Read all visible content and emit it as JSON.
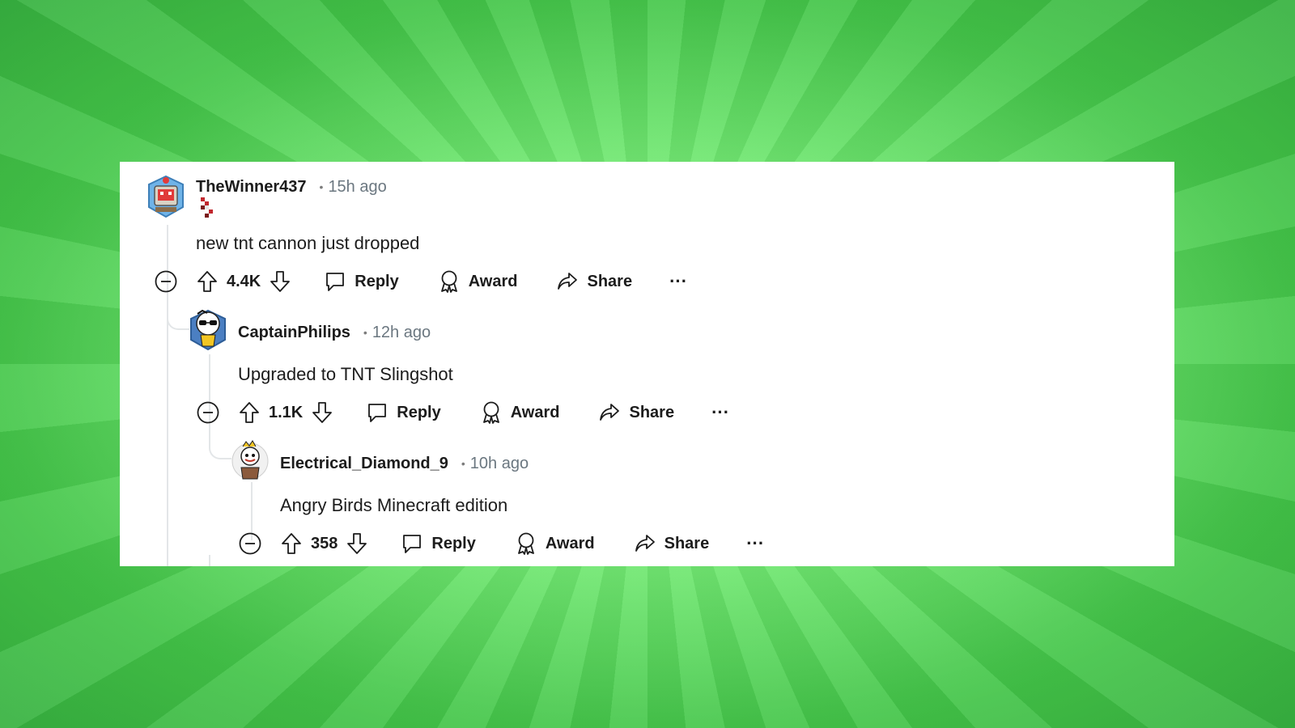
{
  "comments": [
    {
      "username": "TheWinner437",
      "separator": "•",
      "time": "15h ago",
      "text": "new tnt cannon just dropped",
      "votes": "4.4K",
      "reply_label": "Reply",
      "award_label": "Award",
      "share_label": "Share",
      "more_label": "···"
    },
    {
      "username": "CaptainPhilips",
      "separator": "•",
      "time": "12h ago",
      "text": "Upgraded to TNT Slingshot",
      "votes": "1.1K",
      "reply_label": "Reply",
      "award_label": "Award",
      "share_label": "Share",
      "more_label": "···"
    },
    {
      "username": "Electrical_Diamond_9",
      "separator": "•",
      "time": "10h ago",
      "text": "Angry Birds Minecraft edition",
      "votes": "358",
      "reply_label": "Reply",
      "award_label": "Award",
      "share_label": "Share",
      "more_label": "···"
    }
  ],
  "colors": {
    "background_green": "#6ef06e",
    "card": "#ffffff",
    "text": "#1c1c1c",
    "muted": "#6b7780",
    "thread_line": "#e3e6e8"
  },
  "icons": [
    "avatar-robot",
    "flair-pixel",
    "collapse-icon",
    "upvote-icon",
    "downvote-icon",
    "reply-icon",
    "award-icon",
    "share-icon",
    "more-icon"
  ]
}
